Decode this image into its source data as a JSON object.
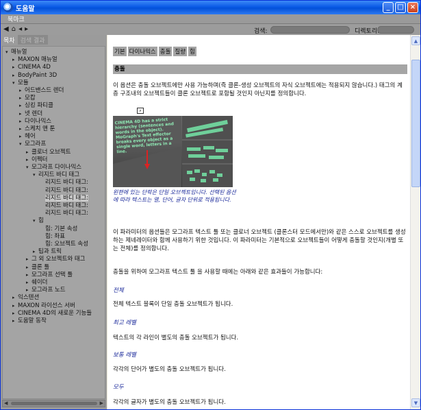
{
  "window": {
    "title": "도움말"
  },
  "menubar": {
    "items": [
      "북마크"
    ]
  },
  "toolbar": {
    "search_label": "검색:",
    "directory_label": "디렉토리:",
    "icons": [
      "back-icon",
      "home-icon",
      "prev-icon",
      "next-icon"
    ]
  },
  "left_tabs": [
    "목차",
    "검색 결과"
  ],
  "tree": [
    {
      "label": "매뉴얼",
      "level": 0,
      "expanded": true
    },
    {
      "label": "MAXON 매뉴얼",
      "level": 1
    },
    {
      "label": "CINEMA 4D",
      "level": 1
    },
    {
      "label": "BodyPaint 3D",
      "level": 1
    },
    {
      "label": "모듈",
      "level": 1,
      "expanded": true
    },
    {
      "label": "어드밴스드 렌더",
      "level": 2
    },
    {
      "label": "모캅",
      "level": 2
    },
    {
      "label": "싱킹 파티클",
      "level": 2
    },
    {
      "label": "넷 렌더",
      "level": 2
    },
    {
      "label": "다이나믹스",
      "level": 2
    },
    {
      "label": "스케치 앤 툰",
      "level": 2
    },
    {
      "label": "헤어",
      "level": 2
    },
    {
      "label": "모그라프",
      "level": 2,
      "expanded": true
    },
    {
      "label": "클로너 오브젝트",
      "level": 3
    },
    {
      "label": "이펙터",
      "level": 3
    },
    {
      "label": "모그라프 다이나믹스",
      "level": 3,
      "expanded": true
    },
    {
      "label": "리지드 바디 태그",
      "level": 4,
      "expanded": true
    },
    {
      "label": "리지드 바디 태그:",
      "level": 5
    },
    {
      "label": "리지드 바디 태그:",
      "level": 5
    },
    {
      "label": "리지드 바디 태그:",
      "level": 5,
      "selected": true
    },
    {
      "label": "리지드 바디 태그:",
      "level": 5
    },
    {
      "label": "리지드 바디 태그:",
      "level": 5
    },
    {
      "label": "힘",
      "level": 4,
      "expanded": true
    },
    {
      "label": "힘: 기본 속성",
      "level": 5
    },
    {
      "label": "힘: 좌표",
      "level": 5
    },
    {
      "label": "힘: 오브젝트 속성",
      "level": 5
    },
    {
      "label": "팁과 트릭",
      "level": 4
    },
    {
      "label": "그 외 오브젝트와 태그",
      "level": 3
    },
    {
      "label": "클론 툴",
      "level": 3
    },
    {
      "label": "모그라프 선택 툴",
      "level": 3
    },
    {
      "label": "쉐이더",
      "level": 3
    },
    {
      "label": "모그라프 노드",
      "level": 3
    },
    {
      "label": "익스텐션",
      "level": 1
    },
    {
      "label": "MAXON 라이선스 서버",
      "level": 1
    },
    {
      "label": "CINEMA 4D의 새로운 기능들",
      "level": 1
    },
    {
      "label": "도움말 동작",
      "level": 1
    }
  ],
  "content": {
    "breadcrumbs": [
      "기본",
      "다이나믹스",
      "충돌",
      "질량",
      "힘"
    ],
    "section_title": "충돌",
    "intro": "이 옵션은 충돌 오브젝트에만 사용 가능하며(즉 클론-생성 오브젝트의 자식 오브젝트에는 적용되지 않습니다.) 태그의 계층 구조내의 오브젝트들이 클론 오브젝트로 포함될 것인지 아닌지를 정의합니다.",
    "figure_text": "CINEMA 4D has a strict hierarchy (sentences and words in the object). MoGraph's Text effector breaks every object as a single word, letters in a line.",
    "figure_caption": "왼편에 있는 단락은 단일 오브젝트입니다. 선택된 옵션에 따라 텍스트는 열, 단어, 글자 단위로 적용됩니다.",
    "para2": "이 파라미터의 옵션들은 모그라프 텍스트 툴 또는 클로너 오브젝트 (클론스터 모드에서만)와 같은 스스로 오브젝트를 생성하는 제네레이터와 함께 사용하기 위한 것입니다. 이 파라미터는 기본적으로 오브젝트들이 어떻게 충돌할 것인지(개별 또는 전체)를 정의합니다.",
    "para3": "충돌을 위하여 모그라프 텍스트 툴 을 사용할 때에는 아래와 같은 효과들이 가능합니다:",
    "options": [
      {
        "name": "전체",
        "desc": "전체 텍스트 블록이 단일 충돌 오브젝트가 됩니다."
      },
      {
        "name": "최고 레벨",
        "desc": "텍스트의 각 라인이 별도의 충돌 오브젝트가 됩니다."
      },
      {
        "name": "보통 레벨",
        "desc": "각각의 단어가 별도의 충돌 오브젝트가 됩니다."
      },
      {
        "name": "모두",
        "desc": "각각의 글자가 별도의 충돌 오브젝트가 됩니다."
      }
    ]
  },
  "colors": {
    "titlebar": "#0a5ae6",
    "panel": "#9b9b9b",
    "link": "#1b2a9b"
  }
}
